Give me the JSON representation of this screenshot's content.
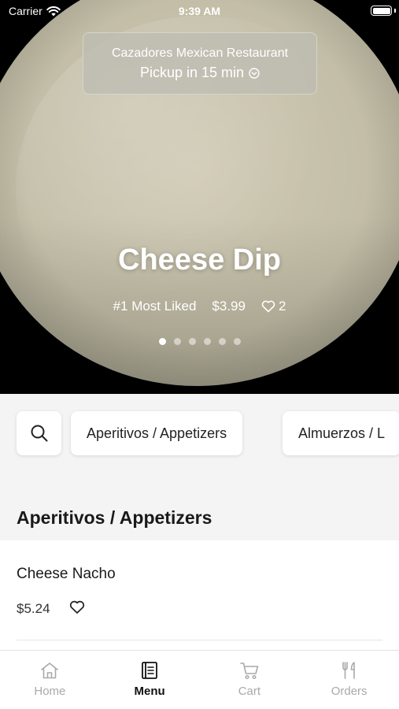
{
  "status_bar": {
    "carrier": "Carrier",
    "time": "9:39 AM"
  },
  "pickup": {
    "restaurant": "Cazadores Mexican Restaurant",
    "time_label": "Pickup in 15 min"
  },
  "featured": {
    "title": "Cheese Dip",
    "rank": "#1 Most Liked",
    "price": "$3.99",
    "likes": "2",
    "slide_count": 6,
    "active_slide": 0
  },
  "categories": [
    {
      "label": "Aperitivos / Appetizers"
    },
    {
      "label": "Almuerzos / L"
    }
  ],
  "section": {
    "title": "Aperitivos / Appetizers"
  },
  "menu_items": [
    {
      "name": "Cheese Nacho",
      "price": "$5.24"
    }
  ],
  "tabs": [
    {
      "label": "Home",
      "icon": "home-icon",
      "active": false
    },
    {
      "label": "Menu",
      "icon": "menu-icon",
      "active": true
    },
    {
      "label": "Cart",
      "icon": "cart-icon",
      "active": false
    },
    {
      "label": "Orders",
      "icon": "orders-icon",
      "active": false
    }
  ],
  "colors": {
    "active_tab": "#111111",
    "inactive_tab": "#a9a9a9",
    "background": "#f4f4f4"
  }
}
